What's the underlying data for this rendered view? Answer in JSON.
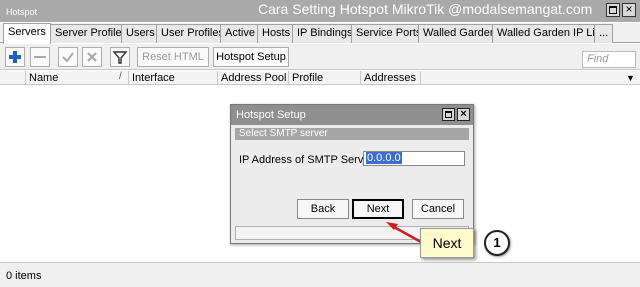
{
  "window": {
    "title": "Hotspot",
    "caption": "Cara Setting Hotspot MikroTik @modalsemangat.com"
  },
  "tabs": [
    {
      "label": "Servers",
      "active": true
    },
    {
      "label": "Server Profiles"
    },
    {
      "label": "Users"
    },
    {
      "label": "User Profiles"
    },
    {
      "label": "Active"
    },
    {
      "label": "Hosts"
    },
    {
      "label": "IP Bindings"
    },
    {
      "label": "Service Ports"
    },
    {
      "label": "Walled Garden"
    },
    {
      "label": "Walled Garden IP List"
    },
    {
      "label": "..."
    }
  ],
  "toolbar": {
    "add_icon": "plus-icon",
    "remove_icon": "minus-icon",
    "enable_icon": "check-icon",
    "disable_icon": "x-icon",
    "filter_icon": "funnel-icon",
    "reset_html_label": "Reset HTML",
    "hotspot_setup_label": "Hotspot Setup",
    "search_placeholder": "Find"
  },
  "table": {
    "columns": [
      "Name",
      "Interface",
      "Address Pool",
      "Profile",
      "Addresses ..."
    ],
    "sort_icon": "/",
    "column_dropdown_icon": "▼",
    "rows": []
  },
  "status": {
    "items_count": "0 items"
  },
  "dialog": {
    "title": "Hotspot Setup",
    "section": "Select SMTP server",
    "field_label": "IP Address of SMTP Server:",
    "field_value": "0.0.0.0",
    "back_label": "Back",
    "next_label": "Next",
    "cancel_label": "Cancel"
  },
  "annotation": {
    "callout_text": "Next",
    "step_number": "1",
    "arrow_color": "#cc1f1f"
  },
  "colors": {
    "titlebar": "#a9a9a9",
    "dialog_title": "#8f8f8f",
    "selection": "#3a6fd1",
    "callout_bg": "#fffaca",
    "add_icon": "#1f5fbf"
  }
}
